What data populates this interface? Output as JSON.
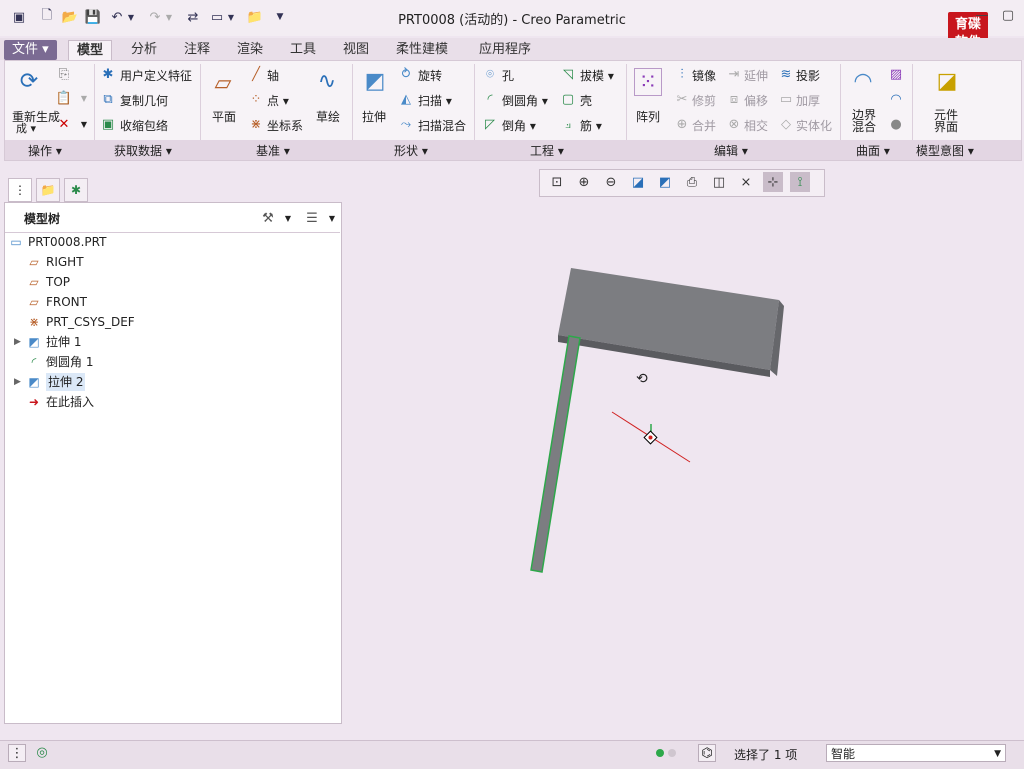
{
  "window": {
    "title": "PRT0008 (活动的) - Creo Parametric",
    "logo_text": "育碟\n软件"
  },
  "quick_access": [
    "app-icon",
    "new-icon",
    "open-icon",
    "save-icon",
    "undo-icon",
    "redo-icon",
    "regenerate-icon",
    "windows-icon",
    "folder-icon",
    "more-icon"
  ],
  "tabs": [
    "文件",
    "模型",
    "分析",
    "注释",
    "渲染",
    "工具",
    "视图",
    "柔性建模",
    "应用程序"
  ],
  "active_tab": "模型",
  "ribbon": {
    "operations": {
      "regen": "重新生成",
      "regen2": "成"
    },
    "get_data": {
      "udf": "用户定义特征",
      "copy_geom": "复制几何",
      "shrinkwrap": "收缩包络"
    },
    "datum": {
      "plane": "平面",
      "axis": "轴",
      "point": "点",
      "csys": "坐标系",
      "sketch": "草绘"
    },
    "shapes": {
      "extrude": "拉伸",
      "revolve": "旋转",
      "sweep": "扫描",
      "swept_blend": "扫描混合"
    },
    "engineering": {
      "hole": "孔",
      "round": "倒圆角",
      "chamfer": "倒角",
      "draft": "拔模",
      "shell": "壳",
      "rib": "筋"
    },
    "editing": {
      "pattern": "阵列",
      "mirror": "镜像",
      "trim": "修剪",
      "merge": "合并",
      "extend": "延伸",
      "offset": "偏移",
      "intersect": "相交",
      "project": "投影",
      "thicken": "加厚",
      "solidify": "实体化"
    },
    "surfaces": {
      "boundary": "边界",
      "boundary2": "混合"
    },
    "model_intent": {
      "component": "元件",
      "component2": "界面"
    }
  },
  "groups": [
    "操作",
    "获取数据",
    "基准",
    "形状",
    "工程",
    "编辑",
    "曲面",
    "模型意图"
  ],
  "model_tree": {
    "title": "模型树",
    "items": [
      {
        "label": "PRT0008.PRT",
        "icon": "part-icon",
        "expandable": false
      },
      {
        "label": "RIGHT",
        "icon": "datum-plane-icon",
        "expandable": false
      },
      {
        "label": "TOP",
        "icon": "datum-plane-icon",
        "expandable": false
      },
      {
        "label": "FRONT",
        "icon": "datum-plane-icon",
        "expandable": false
      },
      {
        "label": "PRT_CSYS_DEF",
        "icon": "csys-icon",
        "expandable": false
      },
      {
        "label": "拉伸 1",
        "icon": "extrude-icon",
        "expandable": true
      },
      {
        "label": "倒圆角 1",
        "icon": "round-icon",
        "expandable": false
      },
      {
        "label": "拉伸 2",
        "icon": "extrude-icon",
        "expandable": true
      },
      {
        "label": "在此插入",
        "icon": "insert-arrow-icon",
        "expandable": false
      }
    ]
  },
  "status": {
    "selection": "选择了 1 项",
    "filter": "智能"
  },
  "colors": {
    "background": "#efe6f0",
    "model": "#7a7c80",
    "highlight": "#2da84a",
    "accent": "#7b6b93"
  }
}
